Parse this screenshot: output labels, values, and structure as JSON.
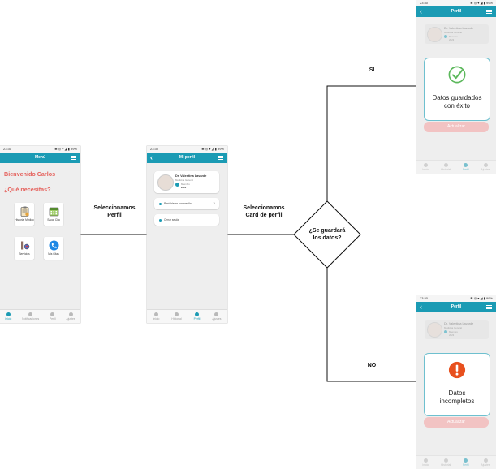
{
  "status_bar": {
    "time": "23:30",
    "indicators": "✽ ◎ ▾ ◢ ▮ 99%"
  },
  "screen_home": {
    "title": "Menú",
    "welcome": "Bienvenido Carlos",
    "question": "¿Qué necesitas?",
    "tiles": [
      {
        "label": "Historial Médico",
        "icon": "clipboard-icon"
      },
      {
        "label": "Sacar Cita",
        "icon": "calendar-icon"
      },
      {
        "label": "Servicios",
        "icon": "medical-equipment-icon"
      },
      {
        "label": "Mis Citas",
        "icon": "phone-icon"
      }
    ],
    "nav": [
      "Inicio",
      "Notificaciones",
      "Perfil",
      "Ajustes"
    ]
  },
  "screen_profile": {
    "title": "Mi perfil",
    "name": "Dr. Valentina Lavarde",
    "role": "Medicina General",
    "meta": "Miembro",
    "meta_value": "2023",
    "options": [
      "Restablecer contraseña",
      "Cerrar sesión"
    ],
    "nav": [
      "Inicio",
      "Historial",
      "Perfil",
      "Ajustes"
    ]
  },
  "screen_result_ok": {
    "title": "Perfil",
    "name": "Dr. Valentina Lavarde",
    "role": "Medicina General",
    "meta": "Miembro",
    "meta_value": "2023",
    "message_line1": "Datos guardados",
    "message_line2": "con éxito",
    "button": "Actualizar",
    "nav": [
      "Inicio",
      "Historial",
      "Perfil",
      "Ajustes"
    ]
  },
  "screen_result_error": {
    "title": "Perfil",
    "name": "Dr. Valentina Lavarde",
    "role": "Medicina General",
    "meta": "Miembro",
    "meta_value": "2023",
    "message_line1": "Datos",
    "message_line2": "incompletos",
    "button": "Actualizar",
    "nav": [
      "Inicio",
      "Historial",
      "Perfil",
      "Ajustes"
    ]
  },
  "flow": {
    "step1_line1": "Seleccionamos",
    "step1_line2": "Perfil",
    "step2_line1": "Seleccionamos",
    "step2_line2": "Card de perfil",
    "decision_line1": "¿Se guardará",
    "decision_line2": "los datos?",
    "yes_label": "SI",
    "no_label": "NO"
  },
  "colors": {
    "appbar": "#1b9bb4",
    "accent_red": "#e5615c",
    "success": "#5cb85c",
    "error": "#e8501e",
    "button_disabled": "#f2c3c3"
  }
}
